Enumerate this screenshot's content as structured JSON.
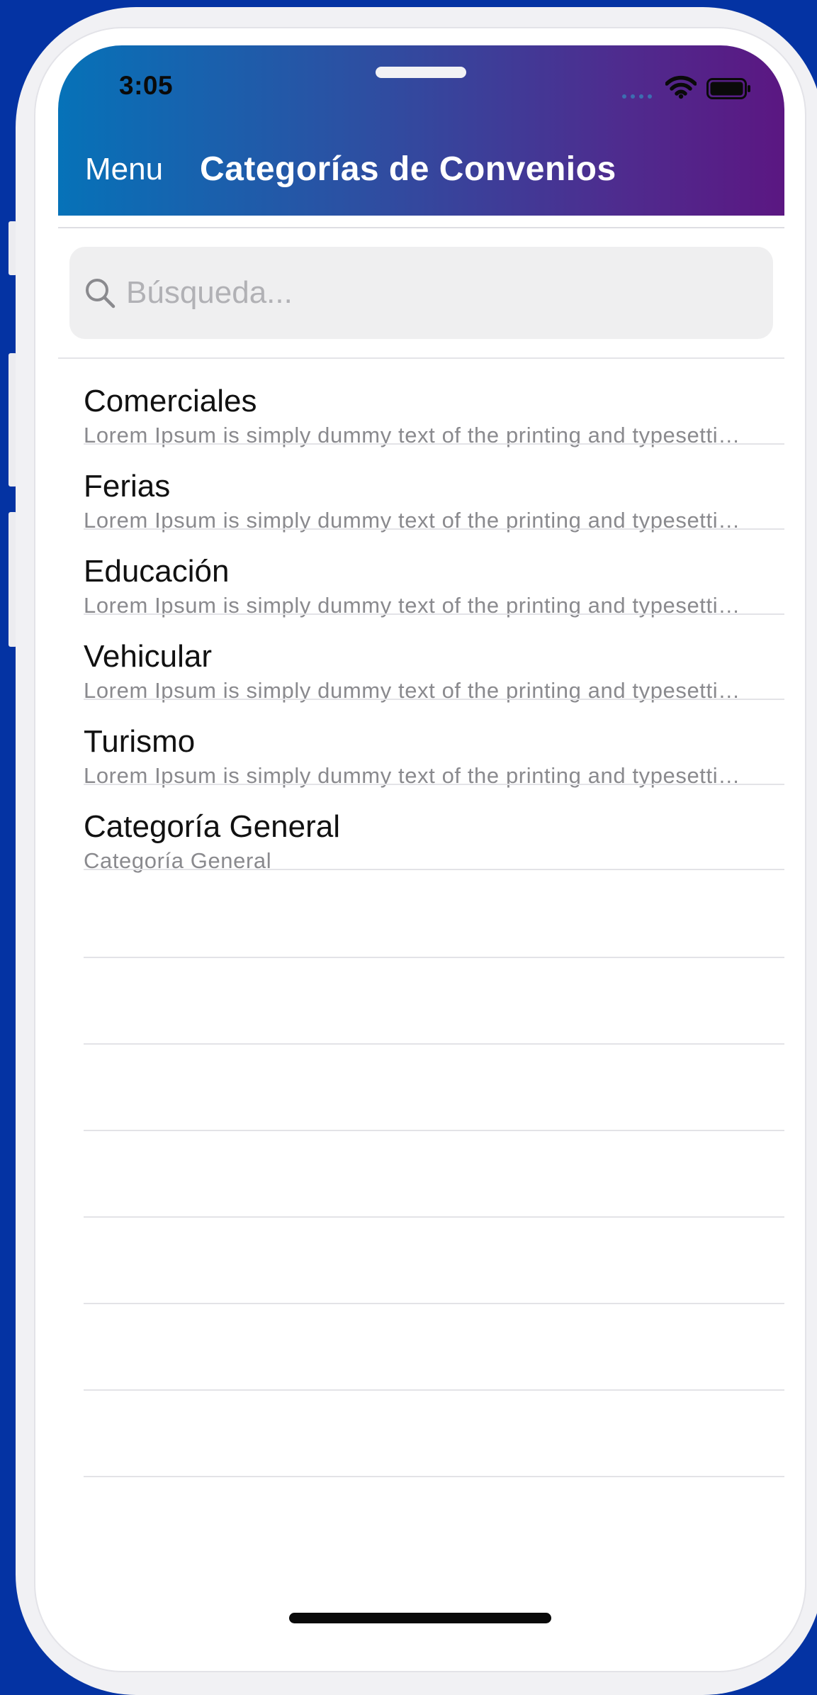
{
  "status_bar": {
    "time": "3:05",
    "icons": [
      "cellular-signal-icon",
      "wifi-icon",
      "battery-icon"
    ]
  },
  "nav": {
    "menu_label": "Menu",
    "title": "Categorías de Convenios"
  },
  "search": {
    "placeholder": "Búsqueda...",
    "value": "",
    "icon": "search-icon"
  },
  "categories": [
    {
      "title": "Comerciales",
      "subtitle": "Lorem Ipsum is simply dummy text of the printing and typesetting industry."
    },
    {
      "title": "Ferias",
      "subtitle": "Lorem Ipsum is simply dummy text of the printing and typesetting industry."
    },
    {
      "title": "Educación",
      "subtitle": "Lorem Ipsum is simply dummy text of the printing and typesetting industry."
    },
    {
      "title": "Vehicular",
      "subtitle": "Lorem Ipsum is simply dummy text of the printing and typesetting industry."
    },
    {
      "title": "Turismo",
      "subtitle": "Lorem Ipsum is simply dummy text of the printing and typesetting industry."
    },
    {
      "title": "Categoría General",
      "subtitle": "Categoría General"
    }
  ],
  "colors": {
    "background": "#0433a3",
    "header_gradient_start": "#0672b8",
    "header_gradient_end": "#5b1782",
    "title_text": "#ffffff",
    "subtitle_text": "#8a8a8e",
    "search_background": "#efeff0"
  }
}
